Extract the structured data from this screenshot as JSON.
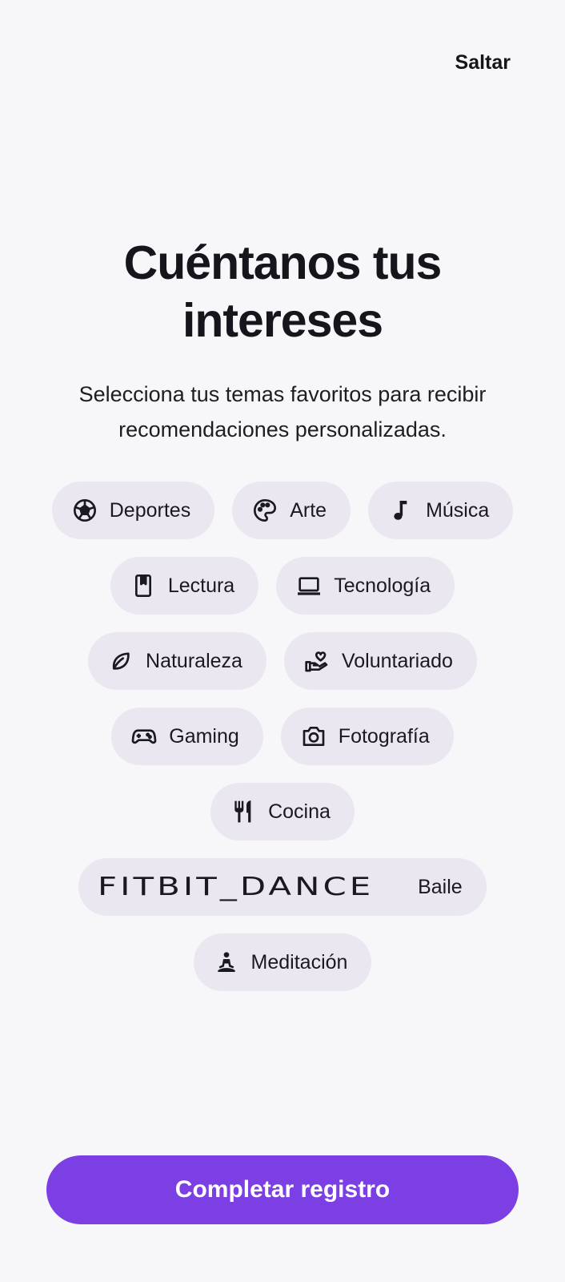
{
  "header": {
    "skip_label": "Saltar"
  },
  "title": {
    "line1": "Cuéntanos tus",
    "line2": "intereses"
  },
  "subtitle": "Selecciona tus temas favoritos para recibir recomendaciones personalizadas.",
  "interests": {
    "deportes": {
      "label": "Deportes",
      "icon": "soccer-ball-icon"
    },
    "arte": {
      "label": "Arte",
      "icon": "palette-icon"
    },
    "musica": {
      "label": "Música",
      "icon": "music-note-icon"
    },
    "lectura": {
      "label": "Lectura",
      "icon": "book-icon"
    },
    "tecnologia": {
      "label": "Tecnología",
      "icon": "laptop-icon"
    },
    "naturaleza": {
      "label": "Naturaleza",
      "icon": "leaf-icon"
    },
    "voluntariado": {
      "label": "Voluntariado",
      "icon": "volunteer-hand-heart-icon"
    },
    "gaming": {
      "label": "Gaming",
      "icon": "gamepad-icon"
    },
    "fotografia": {
      "label": "Fotografía",
      "icon": "camera-icon"
    },
    "cocina": {
      "label": "Cocina",
      "icon": "fork-knife-icon"
    },
    "baile": {
      "label": "Baile",
      "icon_text": "FITBIT_DANCE"
    },
    "meditacion": {
      "label": "Meditación",
      "icon": "meditation-icon"
    }
  },
  "cta_label": "Completar registro",
  "colors": {
    "background": "#f7f6f9",
    "chip": "#ebe7f1",
    "accent": "#7b3fe4",
    "text": "#17151c"
  }
}
